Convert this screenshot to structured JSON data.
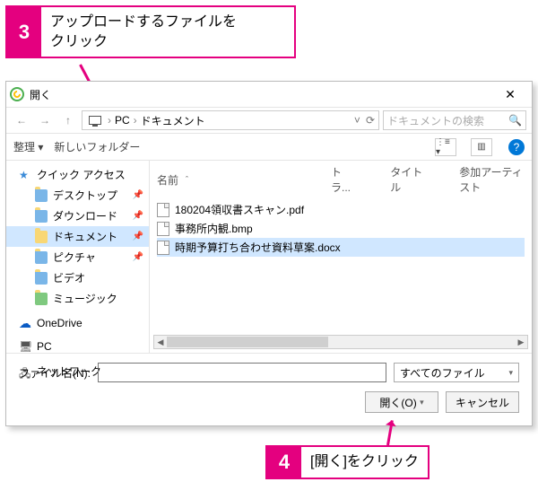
{
  "callouts": {
    "c3": {
      "num": "3",
      "text": "アップロードするファイルを\nクリック"
    },
    "c4": {
      "num": "4",
      "text": "[開く]をクリック"
    }
  },
  "dialog": {
    "title": "開く",
    "close": "✕",
    "nav": {
      "back": "←",
      "fwd": "→",
      "up": "↑"
    },
    "breadcrumb": {
      "root": "PC",
      "folder": "ドキュメント",
      "sep": "›",
      "dropdown": "˅",
      "refresh": "⟳"
    },
    "search": {
      "placeholder": "ドキュメントの検索",
      "icon": "🔍"
    },
    "toolbar": {
      "organize": "整理 ▾",
      "newfolder": "新しいフォルダー",
      "view1": "⋮≡ ▾",
      "view2": "▥",
      "help": "?"
    },
    "sidebar": {
      "quick": "クイック アクセス",
      "desktop": "デスクトップ",
      "downloads": "ダウンロード",
      "documents": "ドキュメント",
      "pictures": "ピクチャ",
      "videos": "ビデオ",
      "music": "ミュージック",
      "onedrive": "OneDrive",
      "pc": "PC",
      "network": "ネットワーク"
    },
    "columns": {
      "name": "名前",
      "track": "トラ...",
      "title": "タイトル",
      "artist": "参加アーティスト",
      "sort": "ˆ"
    },
    "files": [
      "180204領収書スキャン.pdf",
      "事務所内観.bmp",
      "時期予算打ち合わせ資料草案.docx"
    ],
    "footer": {
      "label": "ファイル名(N):",
      "filter": "すべてのファイル",
      "open": "開く(O)",
      "cancel": "キャンセル",
      "dropdown": "▾"
    }
  }
}
